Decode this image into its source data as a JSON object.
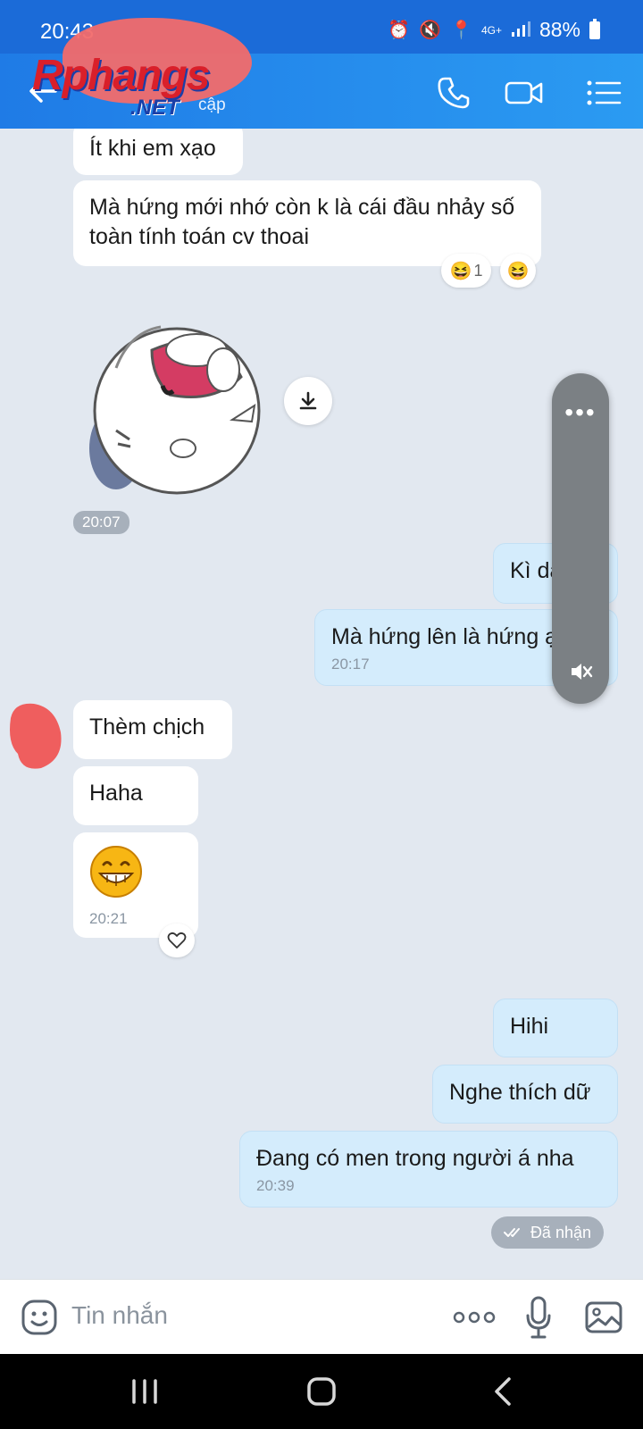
{
  "status_bar": {
    "time": "20:43",
    "network": "4G+",
    "battery": "88%"
  },
  "header": {
    "subtitle_partial": "cập",
    "watermark": "Rphangs",
    "watermark_suffix": ".NET"
  },
  "messages": [
    {
      "text": "Ít khi em xạo",
      "dir": "in"
    },
    {
      "text": "Mà hứng mới nhớ còn k là cái đầu nhảy số toàn tính toán cv thoai",
      "dir": "in",
      "reaction_count": "1"
    },
    {
      "sticker": true,
      "time": "20:07"
    },
    {
      "text": "Kì da ta",
      "dir": "out"
    },
    {
      "text": "Mà hứng lên là hứng ạ",
      "dir": "out",
      "time": "20:17"
    },
    {
      "text": "Thèm chịch",
      "dir": "in"
    },
    {
      "text": "Haha",
      "dir": "in"
    },
    {
      "emoji": true,
      "dir": "in",
      "time": "20:21"
    },
    {
      "text": "Hihi",
      "dir": "out"
    },
    {
      "text": "Nghe thích dữ",
      "dir": "out"
    },
    {
      "text": "Đang có men trong người á nha",
      "dir": "out",
      "time": "20:39"
    }
  ],
  "delivery_status": "Đã nhận",
  "input": {
    "placeholder": "Tin nhắn"
  },
  "colors": {
    "header": "#1f7be6",
    "chat_bg": "#e2e8f0",
    "outgoing_bubble": "#d4ecfc",
    "incoming_bubble": "#ffffff"
  },
  "icons": [
    "back-arrow-icon",
    "phone-icon",
    "video-call-icon",
    "menu-list-icon",
    "download-icon",
    "heart-icon",
    "double-check-icon",
    "emoji-icon",
    "more-dots-icon",
    "microphone-icon",
    "image-icon",
    "mute-icon"
  ]
}
